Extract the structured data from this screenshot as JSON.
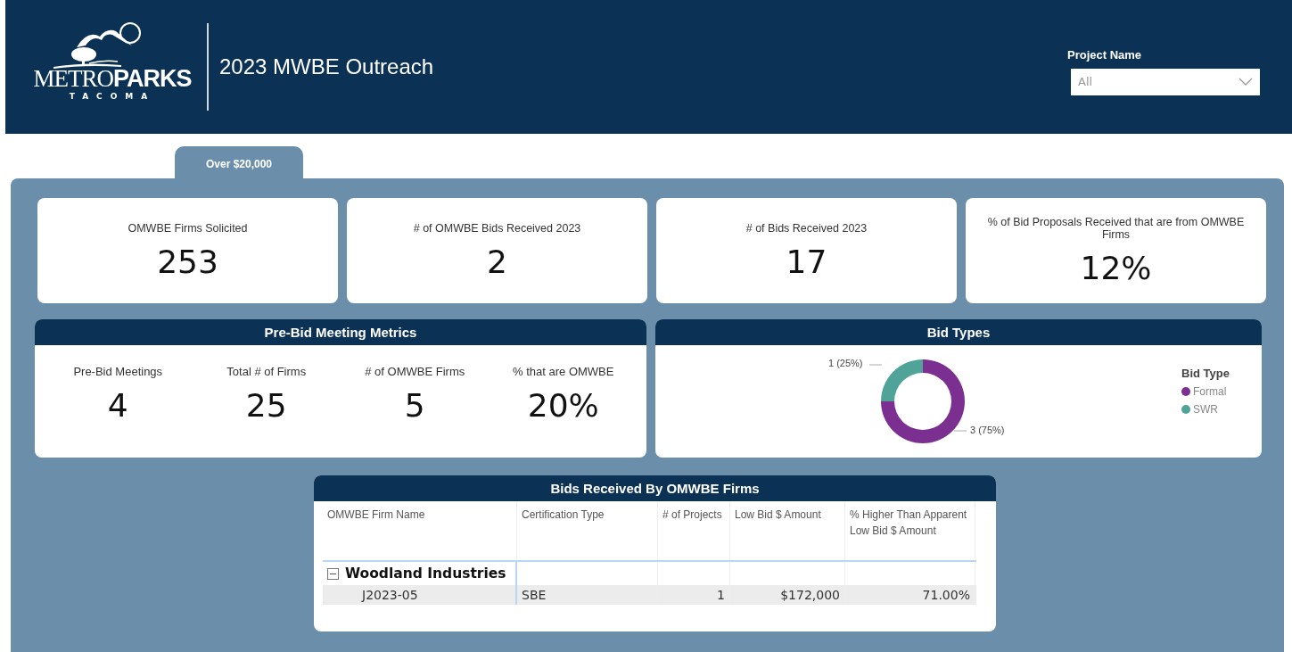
{
  "header": {
    "logo": {
      "light": "METRO",
      "bold": "PARKS",
      "sub": "TACOMA"
    },
    "title": "2023 MWBE Outreach",
    "filter": {
      "label": "Project Name",
      "value": "All"
    }
  },
  "tabs": [
    {
      "label": "Over $20,000",
      "selected": true
    }
  ],
  "kpis": [
    {
      "label": "OMWBE Firms Solicited",
      "value": "253"
    },
    {
      "label": "# of OMWBE Bids Received 2023",
      "value": "2"
    },
    {
      "label": "# of Bids Received 2023",
      "value": "17"
    },
    {
      "label": "% of Bid Proposals Received that are from OMWBE Firms",
      "value": "12%"
    }
  ],
  "pre_bid": {
    "title": "Pre-Bid Meeting Metrics",
    "metrics": [
      {
        "label": "Pre-Bid Meetings",
        "value": "4"
      },
      {
        "label": "Total # of Firms",
        "value": "25"
      },
      {
        "label": "# of OMWBE Firms",
        "value": "5"
      },
      {
        "label": "% that are OMWBE",
        "value": "20%"
      }
    ]
  },
  "bid_types": {
    "title": "Bid Types",
    "chart_data": {
      "type": "donut",
      "categories": [
        "Formal",
        "SWR"
      ],
      "colors": [
        "#7b2f91",
        "#4fa398"
      ],
      "series": [
        {
          "name": "Bid Type",
          "values": [
            75,
            25
          ]
        }
      ],
      "value_labels": [
        "3 (75%)",
        "1 (25%)"
      ]
    }
  },
  "table": {
    "title": "Bids Received By OMWBE Firms",
    "columns": [
      "OMWBE Firm Name",
      "Certification Type",
      "# of Projects",
      "Low Bid $ Amount",
      "% Higher Than Apparent Low Bid $ Amount"
    ],
    "groups": [
      {
        "name": "Woodland Industries",
        "expanded": true,
        "rows": [
          [
            "J2023-05",
            "SBE",
            "1",
            "$172,000",
            "71.00%"
          ]
        ]
      }
    ]
  }
}
